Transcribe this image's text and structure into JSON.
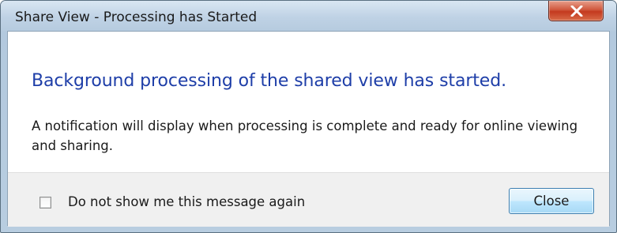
{
  "window": {
    "title": "Share View - Processing has Started",
    "close_icon": "close-x-icon"
  },
  "message": {
    "heading": "Background processing of the shared view has started.",
    "body": "A notification will display when processing is complete and ready for online viewing and sharing."
  },
  "footer": {
    "checkbox_label": "Do not show me this message again",
    "checkbox_checked": false,
    "close_label": "Close"
  },
  "colors": {
    "heading": "#1e3ea8",
    "close_x": "#c43a1f",
    "button_border": "#3c7fb1"
  }
}
